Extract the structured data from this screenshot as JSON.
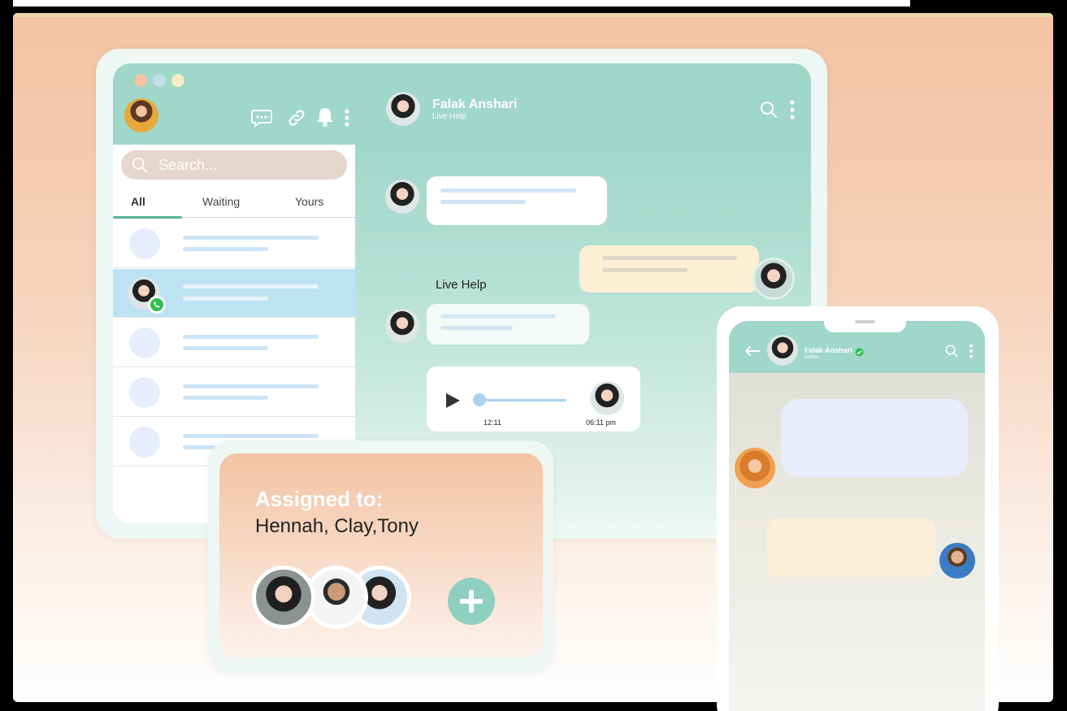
{
  "desktop": {
    "window_dots": [
      "#f3c3a3",
      "#bfe0ea",
      "#f7ecc8"
    ],
    "header_icons": [
      "chat-icon",
      "link-icon",
      "bell-icon",
      "more-icon"
    ],
    "search": {
      "placeholder": "Search..."
    },
    "tabs": [
      "All",
      "Waiting",
      "Yours"
    ],
    "active_tab": "All",
    "contact": {
      "name": "Falak Anshari",
      "status": "Live Help"
    },
    "chat": {
      "label": "Live Help",
      "audio": {
        "duration": "12:11",
        "time": "06:11 pm",
        "progress": 0
      }
    }
  },
  "assigned": {
    "title": "Assigned to:",
    "names": "Hennah, Clay,Tony",
    "add_icon": "plus-icon"
  },
  "phone": {
    "contact_name": "Falak Anshari",
    "contact_status": "Online"
  }
}
